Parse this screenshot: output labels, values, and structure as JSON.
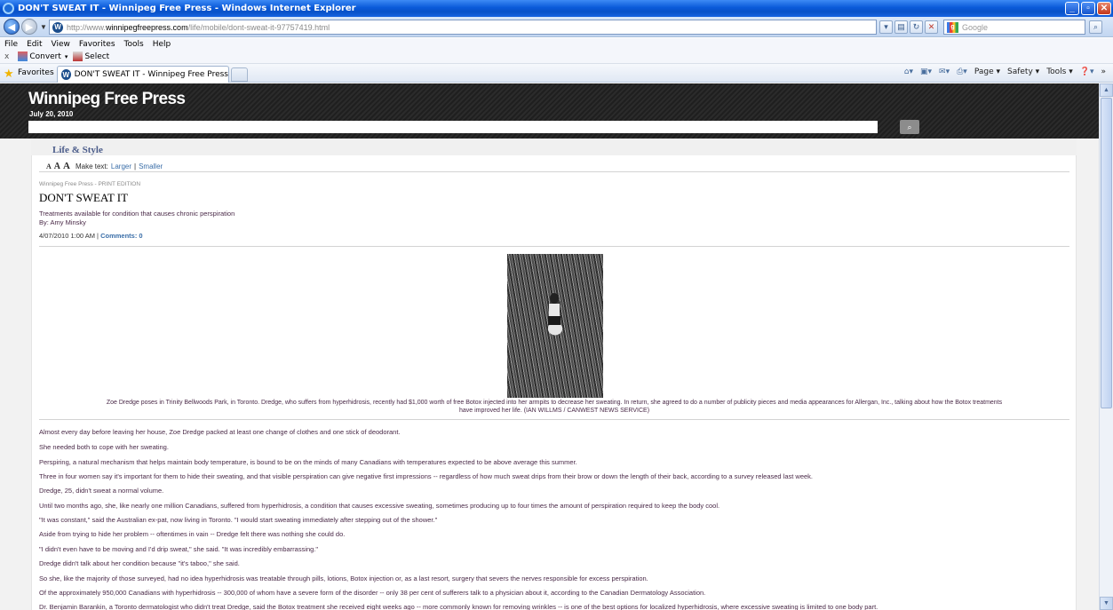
{
  "window": {
    "title": "DON'T SWEAT IT - Winnipeg Free Press - Windows Internet Explorer"
  },
  "address_bar": {
    "url_prefix": "http://www.",
    "url_domain": "winnipegfreepress.com",
    "url_path": "/life/mobile/dont-sweat-it-97757419.html",
    "search_placeholder": "Google"
  },
  "menu": [
    "File",
    "Edit",
    "View",
    "Favorites",
    "Tools",
    "Help"
  ],
  "command_row": {
    "close": "x",
    "convert": "Convert",
    "select": "Select"
  },
  "favorites_bar": {
    "favorites_label": "Favorites",
    "tab_title": "DON'T SWEAT IT - Winnipeg Free Press",
    "commands": [
      "Page",
      "Safety",
      "Tools"
    ]
  },
  "masthead": {
    "logo": "Winnipeg Free Press",
    "date": "July 20, 2010"
  },
  "page": {
    "section": "Life & Style",
    "text_size": {
      "label": "Make text:",
      "larger": "Larger",
      "separator": "|",
      "smaller": "Smaller"
    },
    "article": {
      "kicker": "Winnipeg Free Press - PRINT EDITION",
      "headline": "DON'T SWEAT IT",
      "deck": "Treatments available for condition that causes chronic perspiration",
      "byline": "By: Amy Minsky",
      "date": "4/07/2010 1:00 AM |",
      "comments": "Comments: 0",
      "caption_line1": "Zoe Dredge poses in Trinity Bellwoods Park, in Toronto. Dredge, who suffers from hyperhidrosis, recently had $1,000 worth of free Botox injected into her armpits to decrease her sweating. In return, she agreed to do a number of publicity pieces and media appearances for Allergan, Inc., talking about how the Botox treatments",
      "caption_line2": "have improved her life. (IAN WILLMS / CANWEST NEWS SERVICE)",
      "paragraphs": [
        "Almost every day before leaving her house, Zoe Dredge packed at least one change of clothes and one stick of deodorant.",
        "She needed both to cope with her sweating.",
        "Perspiring, a natural mechanism that helps maintain body temperature, is bound to be on the minds of many Canadians with temperatures expected to be above average this summer.",
        "Three in four women say it's important for them to hide their sweating, and that visible perspiration can give negative first impressions -- regardless of how much sweat drips from their brow or down the length of their back, according to a survey released last week.",
        "Dredge, 25, didn't sweat a normal volume.",
        "Until two months ago, she, like nearly one million Canadians, suffered from hyperhidrosis, a condition that causes excessive sweating, sometimes producing up to four times the amount of perspiration required to keep the body cool.",
        "\"It was constant,\" said the Australian ex-pat, now living in Toronto. \"I would start sweating immediately after stepping out of the shower.\"",
        "Aside from trying to hide her problem -- oftentimes in vain -- Dredge felt there was nothing she could do.",
        "\"I didn't even have to be moving and I'd drip sweat,\" she said. \"It was incredibly embarrassing.\"",
        "Dredge didn't talk about her condition because \"it's taboo,\" she said.",
        "So she, like the majority of those surveyed, had no idea hyperhidrosis was treatable through pills, lotions, Botox injection or, as a last resort, surgery that severs the nerves responsible for excess perspiration.",
        "Of the approximately 950,000 Canadians with hyperhidrosis -- 300,000 of whom have a severe form of the disorder -- only 38 per cent of sufferers talk to a physician about it, according to the Canadian Dermatology Association.",
        "Dr. Benjamin Barankin, a Toronto dermatologist who didn't treat Dredge, said the Botox treatment she received eight weeks ago -- more commonly known for removing wrinkles -- is one of the best options for localized hyperhidrosis, where excessive sweating is limited to one body part."
      ]
    }
  },
  "colors": {
    "accent_link": "#3a6ea8",
    "body_text": "#4a2a48",
    "section_title": "#4b5c8a",
    "masthead": "#262626"
  }
}
